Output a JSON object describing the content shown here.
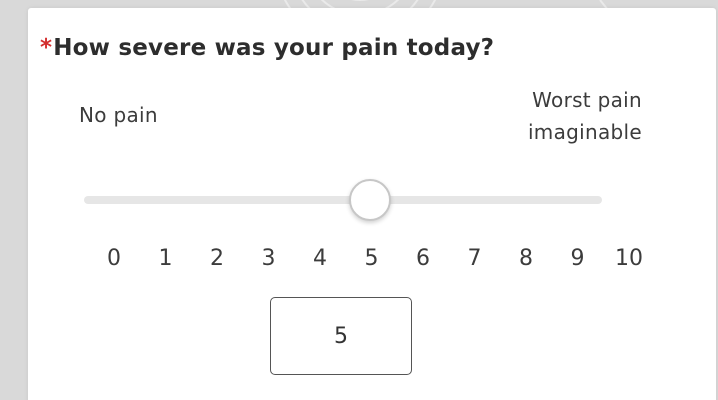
{
  "question": {
    "required_marker": "*",
    "text": "How severe was your pain today?"
  },
  "scale": {
    "min_label": "No pain",
    "max_label_line1": "Worst pain",
    "max_label_line2": "imaginable",
    "min": 0,
    "max": 10,
    "value": 5,
    "ticks": [
      "0",
      "1",
      "2",
      "3",
      "4",
      "5",
      "6",
      "7",
      "8",
      "9",
      "10"
    ]
  },
  "answer": {
    "value": "5"
  },
  "colors": {
    "required": "#d32f2f",
    "track": "#e6e6e6",
    "background": "#d9d9d9"
  }
}
